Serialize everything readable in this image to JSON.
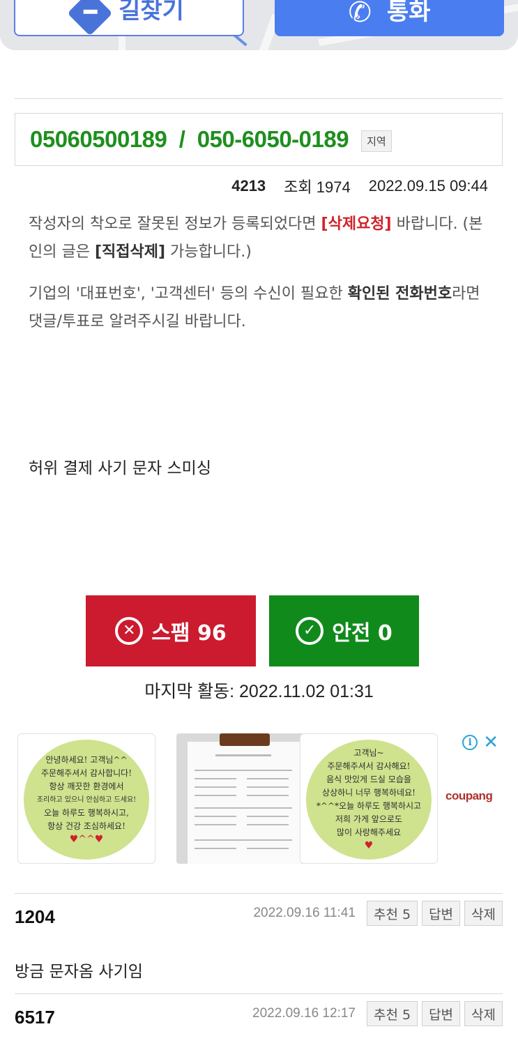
{
  "top_buttons": {
    "directions_label": "길찾기",
    "call_label": "통화"
  },
  "phone": {
    "number_display": "05060500189  /  050-6050-0189",
    "region_badge": "지역"
  },
  "post_meta": {
    "author": "4213",
    "views": "조회 1974",
    "datetime": "2022.09.15 09:44"
  },
  "notice": {
    "line1_a": "작성자의 착오로 잘못된 정보가 등록되었다면 ",
    "delete_request": "[삭제요청]",
    "line1_b": " 바랍니다. (본인의 글은 ",
    "direct_delete": "[직접삭제]",
    "line1_c": " 가능합니다.)",
    "line2_a": "기업의 '대표번호', '고객센터' 등의 수신이 필요한 ",
    "line2_bold": "확인된 전화번호",
    "line2_b": "라면 댓글/투표로 알려주시길 바랍니다."
  },
  "post_content": "허위 결제 사기 문자 스미싱",
  "votes": {
    "spam_label": "스팸 96",
    "safe_label": "안전 0"
  },
  "last_activity": "마지막 활동: 2022.11.02 01:31",
  "ad": {
    "sticker1_lines": [
      "안녕하세요! 고객님^^",
      "주문해주셔서 감사합니다!",
      "항상 깨끗한 환경에서",
      "조리하고 있으니 안심하고 드세요!",
      "오늘 하루도 행복하시고,",
      "항상 건강 조심하세요!"
    ],
    "sticker2_lines": [
      "고객님~",
      "주문해주셔서 감사해요!",
      "음식 맛있게 드실 모습을",
      "상상하니 너무 행복하네요!",
      "*^^*오늘 하루도 행복하시고",
      "저희 가게 앞으로도",
      "많이 사랑해주세요"
    ],
    "brand": "coupang",
    "info_icon": "i",
    "close_icon": "✕"
  },
  "comments": [
    {
      "author": "1204",
      "date": "2022.09.16 11:41",
      "recommend": "추천 5",
      "reply": "답변",
      "delete": "삭제",
      "body": "방금 문자옴 사기임"
    },
    {
      "author": "6517",
      "date": "2022.09.16 12:17",
      "recommend": "추천 5",
      "reply": "답변",
      "delete": "삭제",
      "body": ""
    }
  ],
  "colors": {
    "phone_green": "#1e8f1e",
    "spam_red": "#cc1a2e",
    "safe_green": "#118a1c",
    "notice_red": "#d0242b",
    "call_blue": "#4a7df0"
  }
}
